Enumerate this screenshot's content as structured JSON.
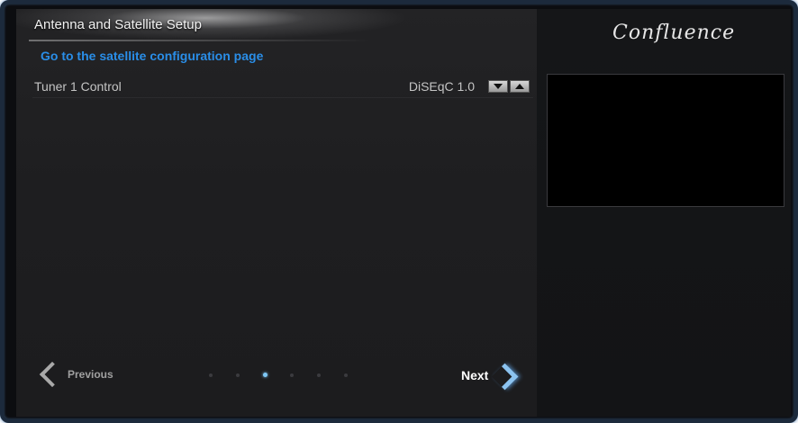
{
  "window": {
    "title": "Antenna and Satellite Setup"
  },
  "main": {
    "config_link": "Go to the satellite configuration page",
    "settings": [
      {
        "label": "Tuner 1 Control",
        "value": "DiSEqC 1.0"
      }
    ]
  },
  "brand": {
    "logo_text": "Confluence"
  },
  "navigation": {
    "previous_label": "Previous",
    "next_label": "Next",
    "page_count": 6,
    "current_page": 3
  },
  "icons": {
    "previous": "chevron-left-icon",
    "next": "chevron-right-icon",
    "spin_down": "triangle-down-icon",
    "spin_up": "triangle-up-icon"
  },
  "colors": {
    "link": "#2a8ee8",
    "active_dot": "#7ec8f6",
    "next_chevron": "#8cc3f0"
  }
}
